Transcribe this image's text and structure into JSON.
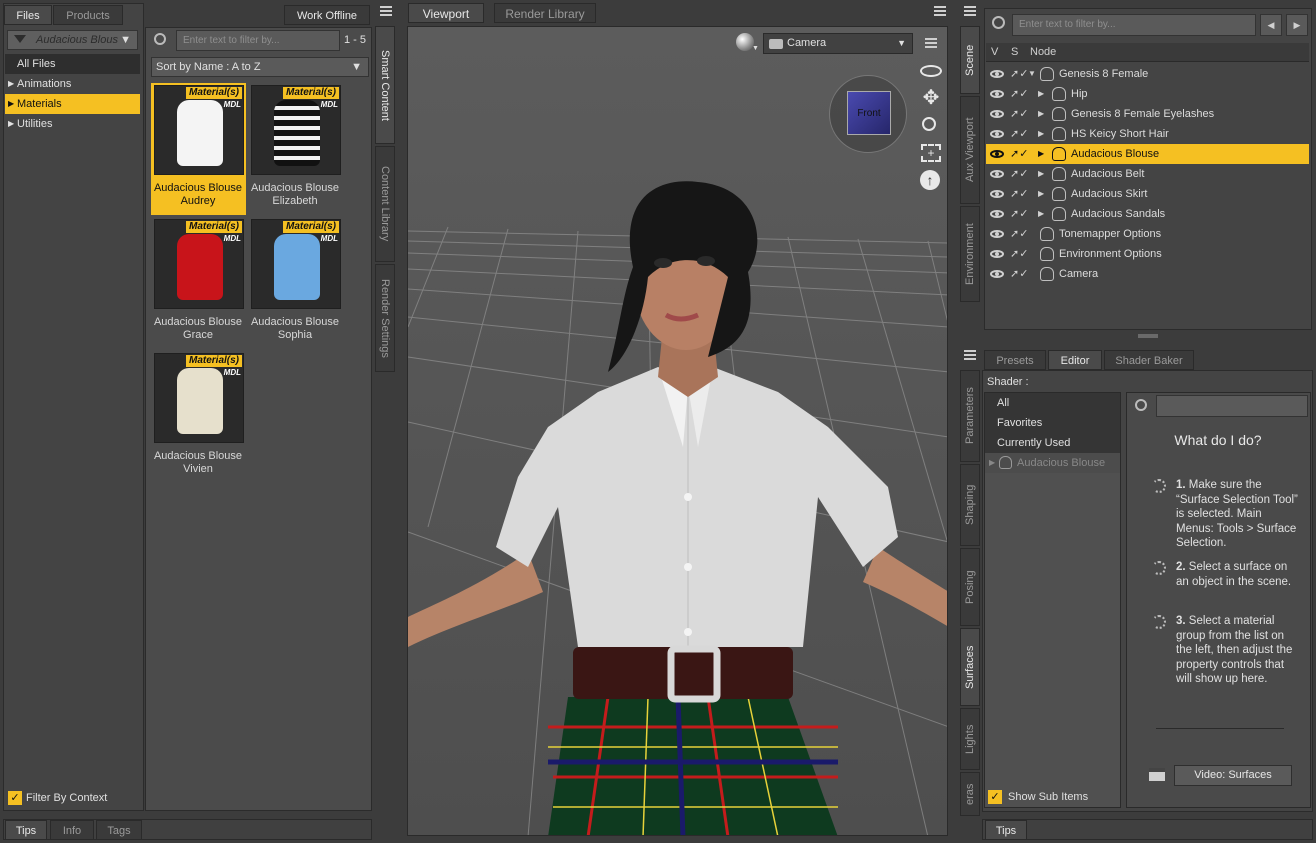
{
  "left_panel": {
    "tabs": [
      "Files",
      "Products"
    ],
    "work_offline": "Work Offline",
    "context_filter": "Audacious Blous",
    "categories": [
      "All Files",
      "Animations",
      "Materials",
      "Utilities"
    ],
    "filter_by_context": "Filter By Context",
    "bottom_tabs": [
      "Tips",
      "Info",
      "Tags"
    ]
  },
  "smart_content": {
    "search_placeholder": "Enter text to filter by...",
    "count": "1 - 5",
    "sort": "Sort by Name : A to Z",
    "badge": "Material(s)",
    "mdl": "MDL",
    "items": [
      {
        "line1": "Audacious Blouse",
        "line2": "Audrey",
        "color": "#f4f4f4"
      },
      {
        "line1": "Audacious Blouse",
        "line2": "Elizabeth",
        "color": "#1a1a1a"
      },
      {
        "line1": "Audacious Blouse",
        "line2": "Grace",
        "color": "#c8141a"
      },
      {
        "line1": "Audacious Blouse",
        "line2": "Sophia",
        "color": "#6aa8e0"
      },
      {
        "line1": "Audacious Blouse",
        "line2": "Vivien",
        "color": "#e6e0cc"
      }
    ]
  },
  "side_tabs_left": [
    "Smart Content",
    "Content Library",
    "Render Settings"
  ],
  "viewport": {
    "tabs": [
      "Viewport",
      "Render Library"
    ],
    "camera": "Camera",
    "cube_label": "Front"
  },
  "scene": {
    "search_placeholder": "Enter text to filter by...",
    "headers": [
      "V",
      "S",
      "Node"
    ],
    "nodes": [
      {
        "label": "Genesis 8 Female",
        "indent": 0,
        "expanded": true
      },
      {
        "label": "Hip",
        "indent": 1
      },
      {
        "label": "Genesis 8 Female Eyelashes",
        "indent": 1
      },
      {
        "label": "HS Keicy Short Hair",
        "indent": 1
      },
      {
        "label": "Audacious Blouse",
        "indent": 1
      },
      {
        "label": "Audacious Belt",
        "indent": 1
      },
      {
        "label": "Audacious Skirt",
        "indent": 1
      },
      {
        "label": "Audacious Sandals",
        "indent": 1
      },
      {
        "label": "Tonemapper Options",
        "indent": 0
      },
      {
        "label": "Environment Options",
        "indent": 0
      },
      {
        "label": "Camera",
        "indent": 0
      }
    ]
  },
  "side_tabs_right": [
    "Scene",
    "Aux Viewport",
    "Environment"
  ],
  "side_tabs_right2": [
    "Parameters",
    "Shaping",
    "Posing",
    "Surfaces",
    "Lights",
    "eras"
  ],
  "surfaces": {
    "tabs": [
      "Presets",
      "Editor",
      "Shader Baker"
    ],
    "shader_label": "Shader :",
    "list": [
      "All",
      "Favorites",
      "Currently Used",
      "Audacious Blouse"
    ],
    "help_title": "What do I do?",
    "steps": [
      {
        "num": "1.",
        "text": "Make sure the “Surface Selection Tool” is selected. Main Menus: Tools > Surface Selection."
      },
      {
        "num": "2.",
        "text": "Select a surface on an object in the scene."
      },
      {
        "num": "3.",
        "text": "Select a material group from the list on the left, then adjust the property controls that will show up here."
      }
    ],
    "video_button": "Video: Surfaces",
    "show_sub_items": "Show Sub Items",
    "bottom_tab": "Tips"
  }
}
